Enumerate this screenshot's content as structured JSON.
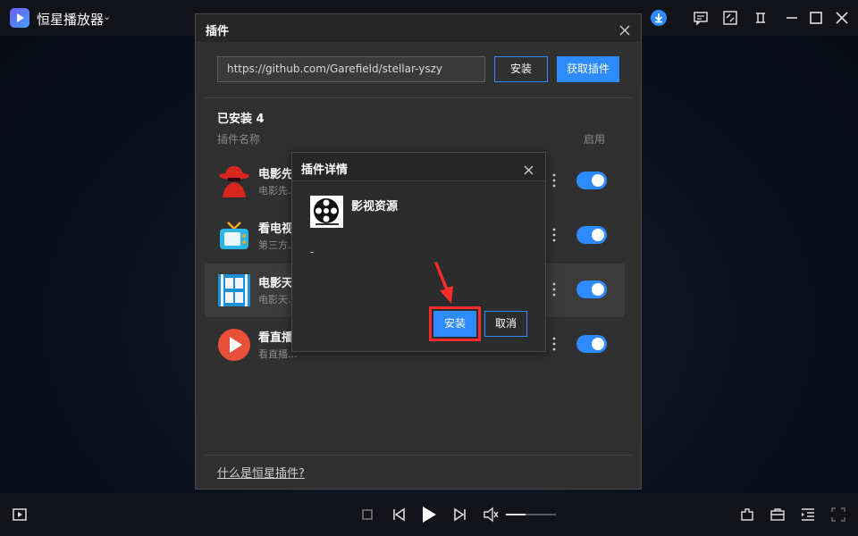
{
  "app": {
    "title": "恒星播放器",
    "icons": {
      "logo": "play-logo-icon",
      "title_caret": "chevron-down-icon",
      "download": "download-circle-icon",
      "feedback": "message-icon",
      "screen": "screen-split-icon",
      "pin": "pin-icon",
      "minimize": "minimize-icon",
      "maximize": "maximize-icon",
      "close": "close-icon"
    }
  },
  "plugin_dialog": {
    "title": "插件",
    "url_value": "https://github.com/Garefield/stellar-yszy",
    "install_label": "安装",
    "get_plugin_label": "获取插件",
    "installed_label": "已安装 4",
    "col_name": "插件名称",
    "col_enable": "启用",
    "help_link": "什么是恒星插件?",
    "plugins": [
      {
        "name": "电影先",
        "desc": "电影先...",
        "icon": "red-hat-spy-icon",
        "enabled": true
      },
      {
        "name": "看电视",
        "desc": "第三方...",
        "icon": "tv-icon",
        "enabled": true
      },
      {
        "name": "电影天",
        "desc": "电影天...",
        "icon": "movie-heaven-icon",
        "enabled": true,
        "highlighted": true
      },
      {
        "name": "看直播",
        "desc": "看直播...",
        "icon": "red-play-icon",
        "enabled": true
      }
    ]
  },
  "detail_dialog": {
    "title": "插件详情",
    "plugin_name": "影视资源",
    "plugin_icon": "film-reel-icon",
    "description": "-",
    "install_label": "安装",
    "cancel_label": "取消",
    "highlight_color": "#ff2a2a"
  },
  "player": {
    "volume_level": 0.4,
    "icons": [
      "playlist-icon",
      "stop-icon",
      "previous-icon",
      "play-icon",
      "next-icon",
      "volume-icon",
      "plugin-icon",
      "toolbox-icon",
      "subtitle-list-icon",
      "fullscreen-icon"
    ]
  },
  "colors": {
    "accent": "#2e8bff",
    "dialog_bg": "#303030",
    "titlebar_bg": "#121319"
  }
}
